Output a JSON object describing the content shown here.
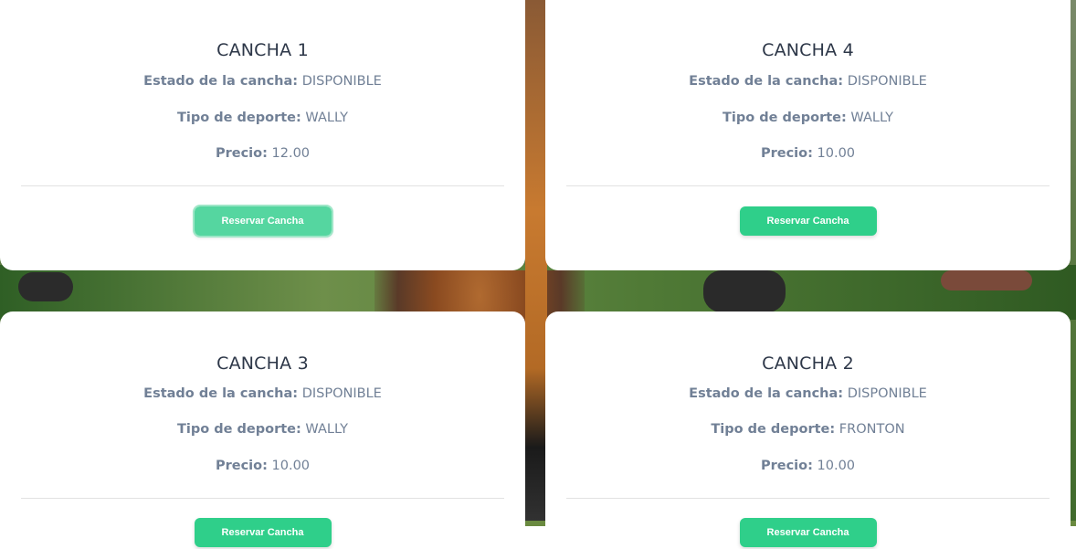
{
  "labels": {
    "estado": "Estado de la cancha:",
    "tipo": "Tipo de deporte:",
    "precio": "Precio:"
  },
  "cards": [
    {
      "title": "CANCHA 1",
      "estado": "DISPONIBLE",
      "tipo": "WALLY",
      "precio": "12.00",
      "button": "Reservar Cancha"
    },
    {
      "title": "CANCHA 4",
      "estado": "DISPONIBLE",
      "tipo": "WALLY",
      "precio": "10.00",
      "button": "Reservar Cancha"
    },
    {
      "title": "CANCHA 3",
      "estado": "DISPONIBLE",
      "tipo": "WALLY",
      "precio": "10.00",
      "button": "Reservar Cancha"
    },
    {
      "title": "CANCHA 2",
      "estado": "DISPONIBLE",
      "tipo": "FRONTON",
      "precio": "10.00",
      "button": "Reservar Cancha"
    }
  ],
  "colors": {
    "accent": "#2fcf8a",
    "card_bg": "#ffffff",
    "title": "#2d3748",
    "text": "#718096"
  }
}
